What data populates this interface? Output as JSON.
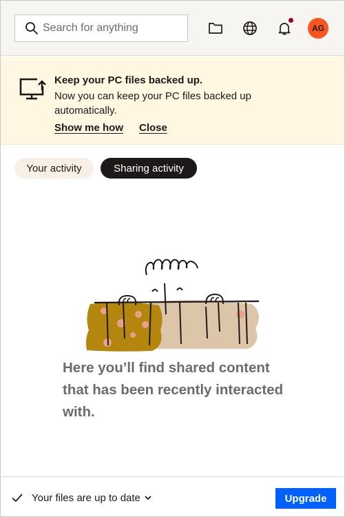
{
  "search": {
    "placeholder": "Search for anything"
  },
  "header": {
    "icons": [
      "folder-icon",
      "globe-icon",
      "bell-icon"
    ],
    "notification_color": "#9b0032",
    "avatar_initials": "AG",
    "avatar_color": "#fa551e"
  },
  "banner": {
    "title": "Keep your PC files backed up.",
    "text": "Now you can keep your PC files backed up automatically.",
    "show_link": "Show me how",
    "close_link": "Close",
    "background": "#fff7e1"
  },
  "tabs": [
    {
      "label": "Your activity",
      "selected": false
    },
    {
      "label": "Sharing activity",
      "selected": true
    }
  ],
  "empty_state": {
    "message": "Here you’ll find shared content that has been recently interacted with."
  },
  "footer": {
    "sync_status": "Your files are up to date",
    "upgrade_label": "Upgrade",
    "accent": "#0061fe"
  }
}
